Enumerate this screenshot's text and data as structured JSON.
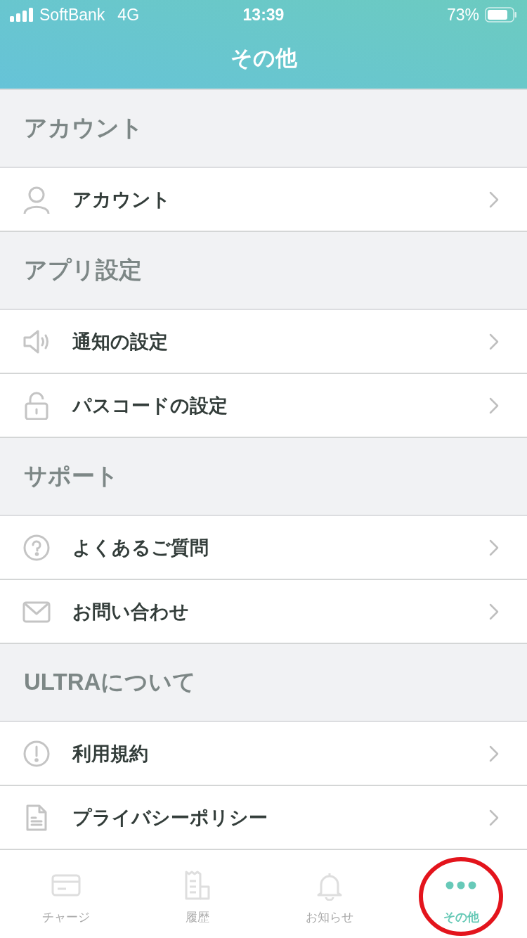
{
  "status_bar": {
    "carrier": "SoftBank",
    "network": "4G",
    "time": "13:39",
    "battery": "73%"
  },
  "header": {
    "title": "その他"
  },
  "sections": [
    {
      "title": "アカウント",
      "items": [
        {
          "kind": "person",
          "label": "アカウント"
        }
      ]
    },
    {
      "title": "アプリ設定",
      "items": [
        {
          "kind": "speaker",
          "label": "通知の設定"
        },
        {
          "kind": "lock",
          "label": "パスコードの設定"
        }
      ]
    },
    {
      "title": "サポート",
      "items": [
        {
          "kind": "question",
          "label": "よくあるご質問"
        },
        {
          "kind": "mail",
          "label": "お問い合わせ"
        }
      ]
    },
    {
      "title": "ULTRAについて",
      "items": [
        {
          "kind": "exclamation",
          "label": "利用規約"
        },
        {
          "kind": "document",
          "label": "プライバシーポリシー"
        }
      ]
    }
  ],
  "tab_bar": [
    {
      "kind": "card",
      "label": "チャージ",
      "selected": false,
      "circled": false
    },
    {
      "kind": "receipt",
      "label": "履歴",
      "selected": false,
      "circled": false
    },
    {
      "kind": "bell",
      "label": "お知らせ",
      "selected": false,
      "circled": false
    },
    {
      "kind": "dots",
      "label": "その他",
      "selected": true,
      "circled": true
    }
  ]
}
